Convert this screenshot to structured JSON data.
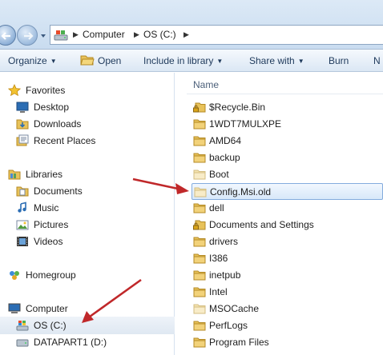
{
  "address": {
    "crumbs": [
      "Computer",
      "OS (C:)"
    ]
  },
  "toolbar": {
    "organize": "Organize",
    "open": "Open",
    "include_in_library": "Include in library",
    "share_with": "Share with",
    "burn": "Burn",
    "overflow": "N"
  },
  "nav": {
    "favorites": "Favorites",
    "desktop": "Desktop",
    "downloads": "Downloads",
    "recent_places": "Recent Places",
    "libraries": "Libraries",
    "documents": "Documents",
    "music": "Music",
    "pictures": "Pictures",
    "videos": "Videos",
    "homegroup": "Homegroup",
    "computer": "Computer",
    "os_c": "OS (C:)",
    "datapart1": "DATAPART1 (D:)"
  },
  "content": {
    "column_name": "Name",
    "files": [
      {
        "name": "$Recycle.Bin",
        "icon": "locked-folder-icon"
      },
      {
        "name": "1WDT7MULXPE",
        "icon": "folder-icon"
      },
      {
        "name": "AMD64",
        "icon": "folder-icon"
      },
      {
        "name": "backup",
        "icon": "folder-icon"
      },
      {
        "name": "Boot",
        "icon": "faded-folder-icon"
      },
      {
        "name": "Config.Msi.old",
        "icon": "faded-folder-icon"
      },
      {
        "name": "dell",
        "icon": "folder-icon"
      },
      {
        "name": "Documents and Settings",
        "icon": "locked-folder-icon"
      },
      {
        "name": "drivers",
        "icon": "folder-icon"
      },
      {
        "name": "I386",
        "icon": "folder-icon"
      },
      {
        "name": "inetpub",
        "icon": "folder-icon"
      },
      {
        "name": "Intel",
        "icon": "folder-icon"
      },
      {
        "name": "MSOCache",
        "icon": "faded-folder-icon"
      },
      {
        "name": "PerfLogs",
        "icon": "folder-icon"
      },
      {
        "name": "Program Files",
        "icon": "folder-icon"
      }
    ]
  },
  "colors": {
    "arrow": "#c0282a",
    "selection_border": "#84acdd",
    "folder": "#e8c25a"
  }
}
